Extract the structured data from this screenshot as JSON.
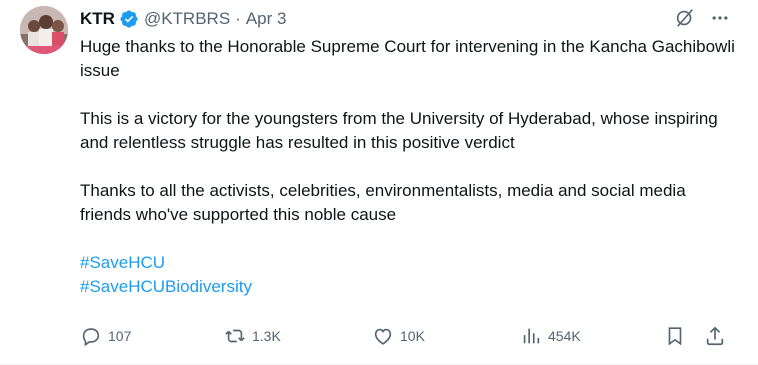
{
  "author": {
    "name": "KTR",
    "handle": "@KTRBRS",
    "separator": "·",
    "date": "Apr 3",
    "verified": true,
    "verified_color": "#1d9bf0"
  },
  "tweet": {
    "paragraphs": [
      "Huge thanks to the Honorable Supreme Court for intervening in the Kancha Gachibowli issue",
      "This is a victory for the youngsters from the University of Hyderabad, whose inspiring and relentless struggle has resulted in this positive verdict",
      "Thanks to all the activists, celebrities, environmentalists, media and social media friends who've supported this noble cause"
    ],
    "hashtags": [
      "#SaveHCU",
      "#SaveHCUBiodiversity"
    ]
  },
  "stats": {
    "replies": "107",
    "reposts": "1.3K",
    "likes": "10K",
    "views": "454K"
  },
  "icons": {
    "top": [
      "grok-icon",
      "more-icon"
    ],
    "actions": [
      "reply-icon",
      "repost-icon",
      "like-icon",
      "views-icon",
      "bookmark-icon",
      "share-icon"
    ]
  },
  "colors": {
    "text": "#0f1419",
    "secondary": "#536471",
    "link": "#1d9bf0"
  }
}
